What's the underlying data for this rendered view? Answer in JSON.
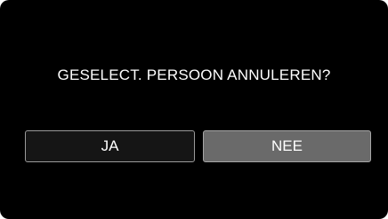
{
  "dialog": {
    "prompt": "GESELECT. PERSOON ANNULEREN?",
    "yes_label": "JA",
    "no_label": "NEE",
    "selected": "no"
  },
  "colors": {
    "background": "#000000",
    "button_default": "#151515",
    "button_selected": "#6a6a6a",
    "text": "#ffffff"
  }
}
